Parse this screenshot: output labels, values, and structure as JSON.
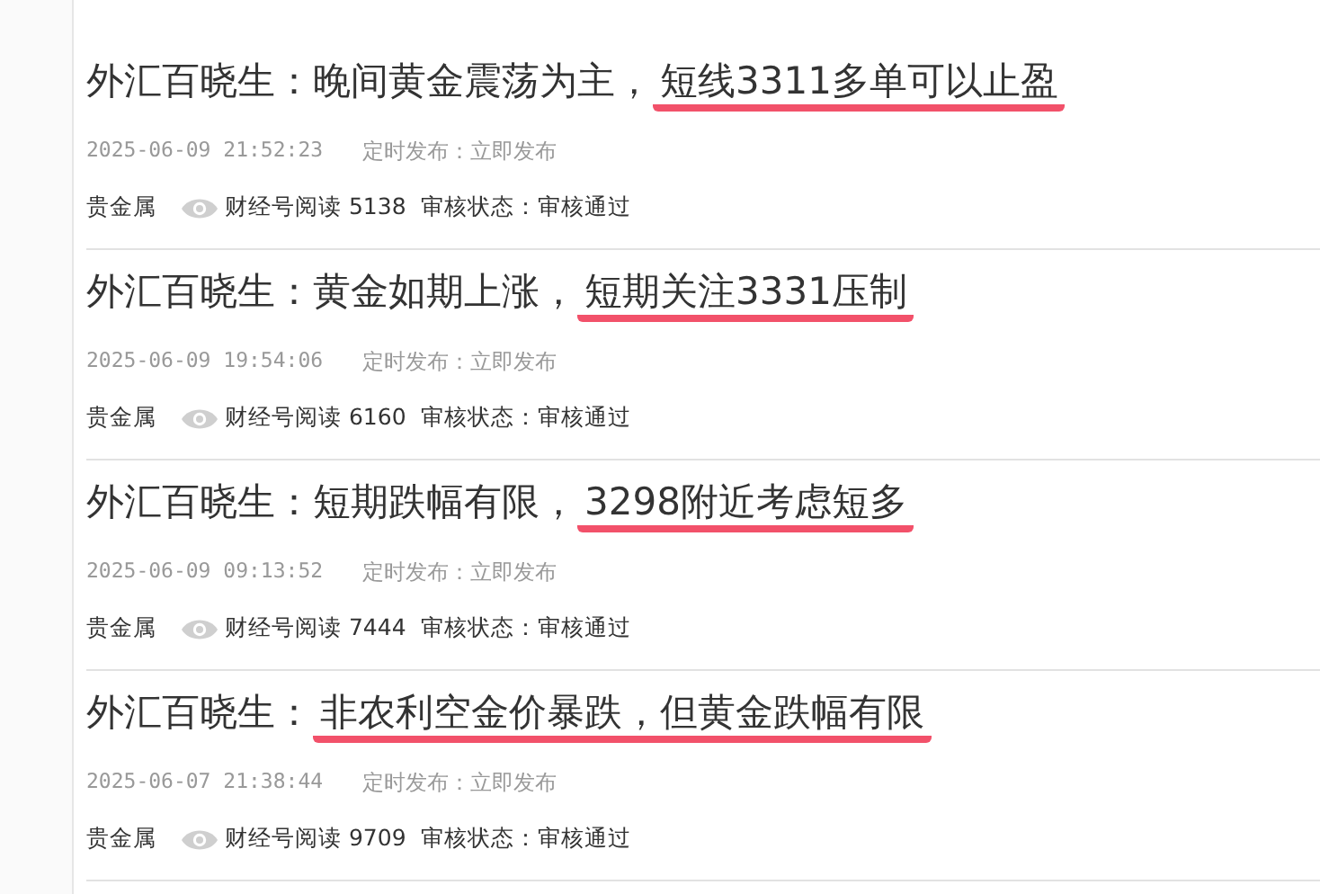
{
  "articles": [
    {
      "title_prefix": "外汇百晓生：晚间黄金震荡为主，",
      "title_highlight": "短线3311多单可以止盈",
      "datetime": "2025-06-09 21:52:23",
      "publish": "定时发布：立即发布",
      "category": "贵金属",
      "reads": "财经号阅读 5138",
      "review": "审核状态：审核通过"
    },
    {
      "title_prefix": "外汇百晓生：黄金如期上涨，",
      "title_highlight": "短期关注3331压制",
      "datetime": "2025-06-09 19:54:06",
      "publish": "定时发布：立即发布",
      "category": "贵金属",
      "reads": "财经号阅读 6160",
      "review": "审核状态：审核通过"
    },
    {
      "title_prefix": "外汇百晓生：短期跌幅有限，",
      "title_highlight": "3298附近考虑短多",
      "datetime": "2025-06-09 09:13:52",
      "publish": "定时发布：立即发布",
      "category": "贵金属",
      "reads": "财经号阅读 7444",
      "review": "审核状态：审核通过"
    },
    {
      "title_prefix": "外汇百晓生：",
      "title_highlight": "非农利空金价暴跌，但黄金跌幅有限",
      "datetime": "2025-06-07 21:38:44",
      "publish": "定时发布：立即发布",
      "category": "贵金属",
      "reads": "财经号阅读 9709",
      "review": "审核状态：审核通过"
    }
  ]
}
